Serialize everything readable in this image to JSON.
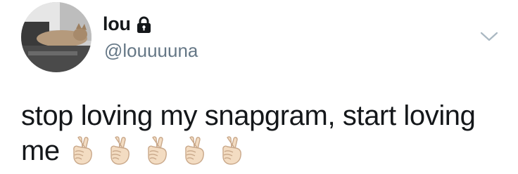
{
  "author": {
    "display_name": "lou",
    "handle": "@louuuuna",
    "avatar_icon": "avatar-cat-photo",
    "protected_icon": "lock-icon"
  },
  "menu": {
    "icon": "chevron-down-icon"
  },
  "tweet": {
    "text_line1": "stop loving my snapgram, start loving",
    "text_line2": "me",
    "emoji": [
      "crossed-fingers-icon",
      "crossed-fingers-icon",
      "crossed-fingers-icon",
      "crossed-fingers-icon",
      "crossed-fingers-icon"
    ]
  },
  "colors": {
    "text_primary": "#14171a",
    "text_secondary": "#657786",
    "skin_tone": "#f3dcc2"
  }
}
